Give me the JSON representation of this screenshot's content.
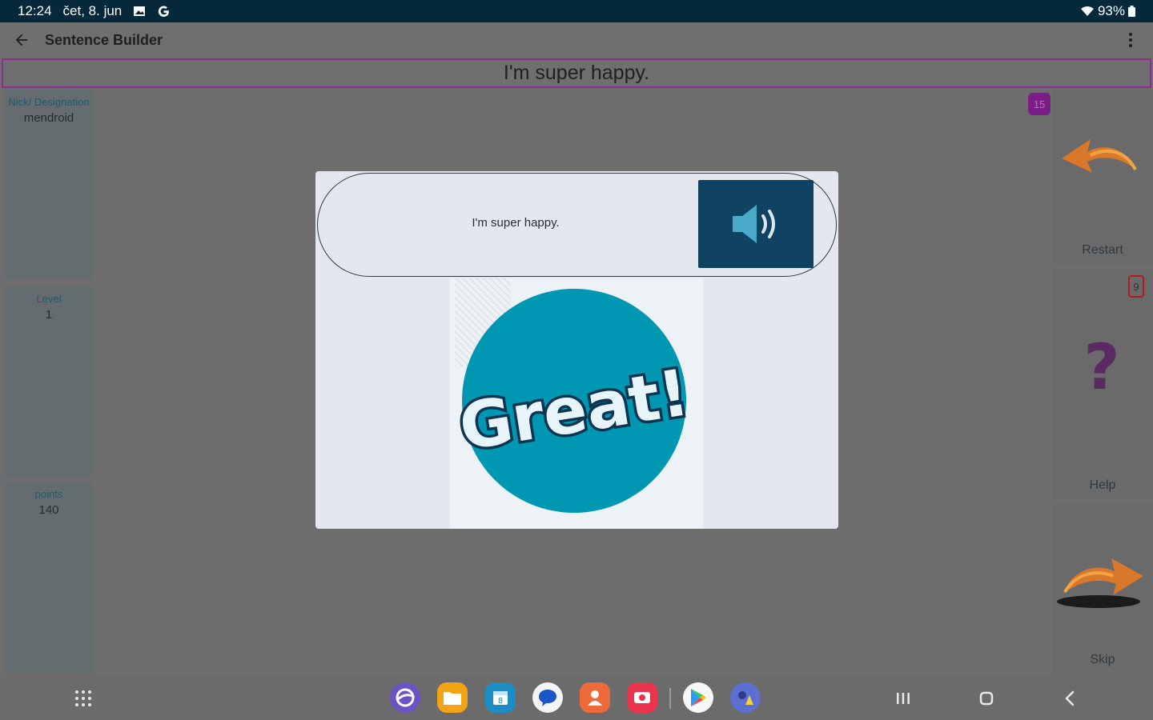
{
  "status_bar": {
    "time": "12:24",
    "date": "čet, 8. jun",
    "battery": "93%",
    "icons": [
      "gallery-icon",
      "google-icon",
      "wifi-icon",
      "battery-icon"
    ]
  },
  "app_bar": {
    "title": "Sentence Builder",
    "icons": [
      "back-arrow-icon",
      "more-vert-icon"
    ]
  },
  "sentence_banner": "I'm super happy.",
  "sidebar": {
    "nick_label": "Nick/ Designation",
    "nick_value": "mendroid",
    "level_label": "Level",
    "level_value": "1",
    "points_label": "points",
    "points_value": "140"
  },
  "right_panel": {
    "count_badge": "15",
    "restart_label": "Restart",
    "help_badge": "9",
    "help_label": "Help",
    "skip_label": "Skip",
    "icons": [
      "restart-arrow-icon",
      "question-mark-icon",
      "skip-arrow-icon"
    ]
  },
  "dialog": {
    "sentence": "I'm super happy.",
    "speaker_icon": "speaker-icon",
    "reward_text": "Great!"
  },
  "nav_bar": {
    "apps": [
      "app-drawer-icon",
      "internet-icon",
      "files-icon",
      "calendar-icon",
      "messages-icon",
      "contacts-icon",
      "screen-recorder-icon",
      "play-store-icon",
      "game-launcher-icon"
    ],
    "buttons": [
      "recents-button",
      "home-button",
      "back-button"
    ]
  },
  "colors": {
    "status_bar": "#05283a",
    "overlay": "#6d6d6d",
    "banner_border": "#8a2d8f",
    "speaker_button": "#0f4361",
    "reward_circle": "#0097b2",
    "reward_text": "#0d3552",
    "badge": "#7a1d86",
    "help_badge_border": "#b01c1c"
  }
}
